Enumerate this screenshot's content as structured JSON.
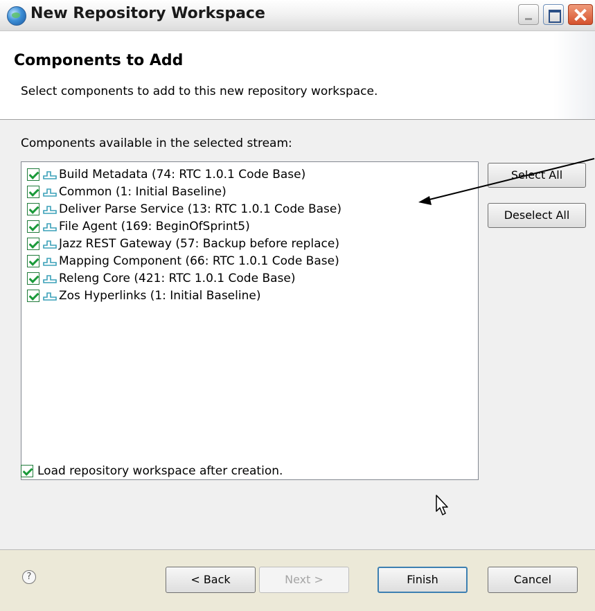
{
  "window": {
    "title": "New Repository Workspace"
  },
  "header": {
    "title": "Components to Add",
    "description": "Select components to add to this new repository workspace."
  },
  "main": {
    "available_label": "Components available in the selected stream:",
    "components": [
      {
        "label": "Build Metadata (74: RTC 1.0.1 Code Base)",
        "checked": true
      },
      {
        "label": "Common (1: Initial Baseline)",
        "checked": true
      },
      {
        "label": "Deliver Parse Service (13: RTC 1.0.1 Code Base)",
        "checked": true
      },
      {
        "label": "File Agent (169: BeginOfSprint5)",
        "checked": true
      },
      {
        "label": "Jazz REST Gateway (57: Backup before replace)",
        "checked": true
      },
      {
        "label": "Mapping Component (66: RTC 1.0.1 Code Base)",
        "checked": true
      },
      {
        "label": "Releng Core (421: RTC 1.0.1 Code Base)",
        "checked": true
      },
      {
        "label": "Zos Hyperlinks (1: Initial Baseline)",
        "checked": true
      }
    ],
    "select_all_label": "Select All",
    "deselect_all_label": "Deselect All",
    "load_option": {
      "label": "Load repository workspace after creation.",
      "checked": true
    }
  },
  "footer": {
    "help_symbol": "?",
    "back_label": "< Back",
    "next_label": "Next >",
    "finish_label": "Finish",
    "cancel_label": "Cancel"
  },
  "colors": {
    "check_green": "#1a9a3a",
    "component_icon": "#3aa0b8",
    "dialog_bg": "#f0f0f0"
  }
}
